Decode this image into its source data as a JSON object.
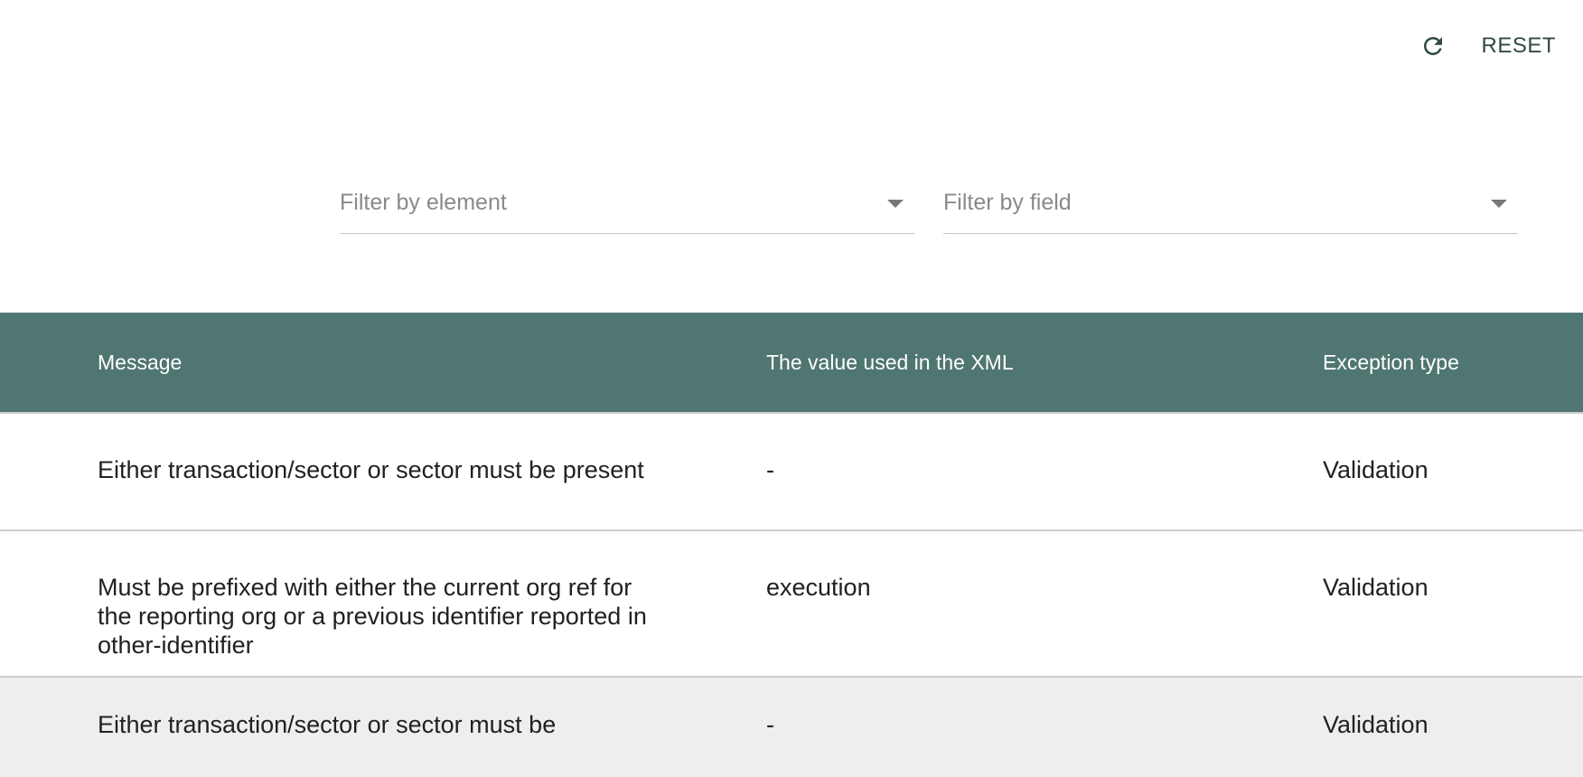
{
  "toolbar": {
    "reset_label": "RESET",
    "reset_icon": "refresh-icon"
  },
  "filters": {
    "element_placeholder": "Filter by element",
    "field_placeholder": "Filter by field"
  },
  "table": {
    "header_color": "#4f7671",
    "columns": [
      "Message",
      "The value used in the XML",
      "Exception type"
    ],
    "rows": [
      {
        "message": "Either transaction/sector or sector must be present",
        "value": "-",
        "type": "Validation"
      },
      {
        "message": "Must be prefixed with either the current org ref for the reporting org or a previous identifier reported in other-identifier",
        "value": "execution",
        "type": "Validation"
      },
      {
        "message": "Either transaction/sector or sector must be",
        "value": "-",
        "type": "Validation"
      }
    ]
  }
}
